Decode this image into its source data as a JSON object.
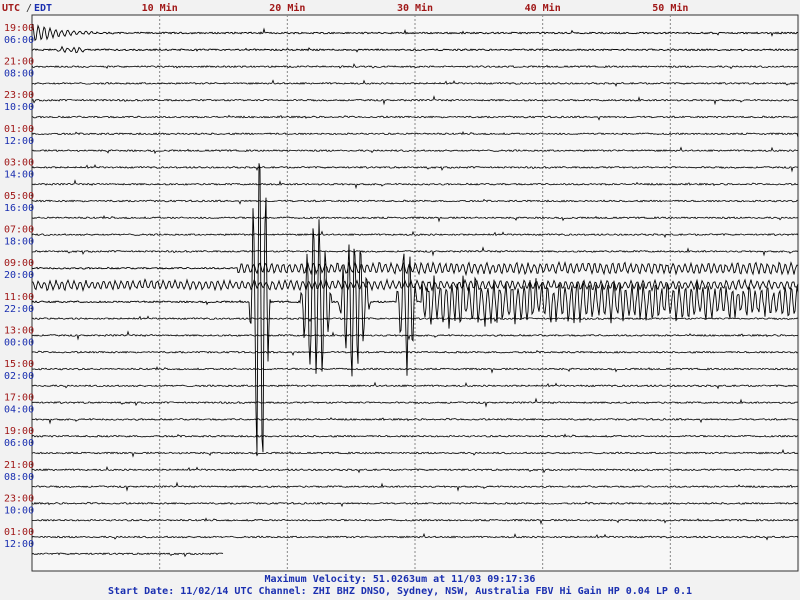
{
  "header": {
    "utc_label": "UTC",
    "separator": "/",
    "local_label": "EDT"
  },
  "minute_labels": [
    "10 Min",
    "20 Min",
    "30 Min",
    "40 Min",
    "50 Min"
  ],
  "footer": {
    "max_velocity": "Maximum Velocity: 51.0263um at 11/03 09:17:36",
    "start_info": "Start Date: 11/02/14 UTC Channel: ZHI  BHZ  DNSO, Sydney, NSW, Australia  FBV Hi Gain HP 0.04 LP 0.1"
  },
  "colors": {
    "utc": "#a01818",
    "local": "#1a2fb0",
    "trace": "#000000",
    "grid": "#888888",
    "background": "#f2f2f2"
  },
  "chart_data": {
    "type": "line",
    "title": "",
    "xlabel": "",
    "ylabel": "",
    "x_unit": "minutes",
    "xlim": [
      0,
      60
    ],
    "x_ticks": [
      10,
      20,
      30,
      40,
      50
    ],
    "grid": true,
    "hour_labels": [
      {
        "utc": "19:00",
        "local": "06:00"
      },
      {
        "utc": "21:00",
        "local": "08:00"
      },
      {
        "utc": "23:00",
        "local": "10:00"
      },
      {
        "utc": "01:00",
        "local": "12:00"
      },
      {
        "utc": "03:00",
        "local": "14:00"
      },
      {
        "utc": "05:00",
        "local": "16:00"
      },
      {
        "utc": "07:00",
        "local": "18:00"
      },
      {
        "utc": "09:00",
        "local": "20:00"
      },
      {
        "utc": "11:00",
        "local": "22:00"
      },
      {
        "utc": "13:00",
        "local": "00:00"
      },
      {
        "utc": "15:00",
        "local": "02:00"
      },
      {
        "utc": "17:00",
        "local": "04:00"
      },
      {
        "utc": "19:00",
        "local": "06:00"
      },
      {
        "utc": "21:00",
        "local": "08:00"
      },
      {
        "utc": "23:00",
        "local": "10:00"
      },
      {
        "utc": "01:00",
        "local": "12:00"
      }
    ],
    "trace_count": 32,
    "last_trace_end_minute": 15,
    "events": [
      {
        "trace": 0,
        "start": 0,
        "end": 8,
        "amplitude": 10,
        "type": "decay"
      },
      {
        "trace": 1,
        "start": 2,
        "end": 4,
        "amplitude": 3,
        "type": "burst"
      },
      {
        "trace": 14,
        "start": 16,
        "end": 60,
        "amplitude": 6,
        "type": "noise"
      },
      {
        "trace": 15,
        "start": 0,
        "end": 60,
        "amplitude": 5,
        "type": "noise"
      },
      {
        "trace": 16,
        "start": 17,
        "end": 19,
        "amplitude": 210,
        "type": "quake"
      },
      {
        "trace": 16,
        "start": 21,
        "end": 24,
        "amplitude": 110,
        "type": "quake"
      },
      {
        "trace": 16,
        "start": 24,
        "end": 27,
        "amplitude": 85,
        "type": "quake"
      },
      {
        "trace": 16,
        "start": 28.5,
        "end": 30.5,
        "amplitude": 80,
        "type": "quake"
      },
      {
        "trace": 16,
        "start": 30.5,
        "end": 60,
        "amplitude": 28,
        "type": "coda"
      }
    ],
    "noise_amplitude": 1.6
  }
}
